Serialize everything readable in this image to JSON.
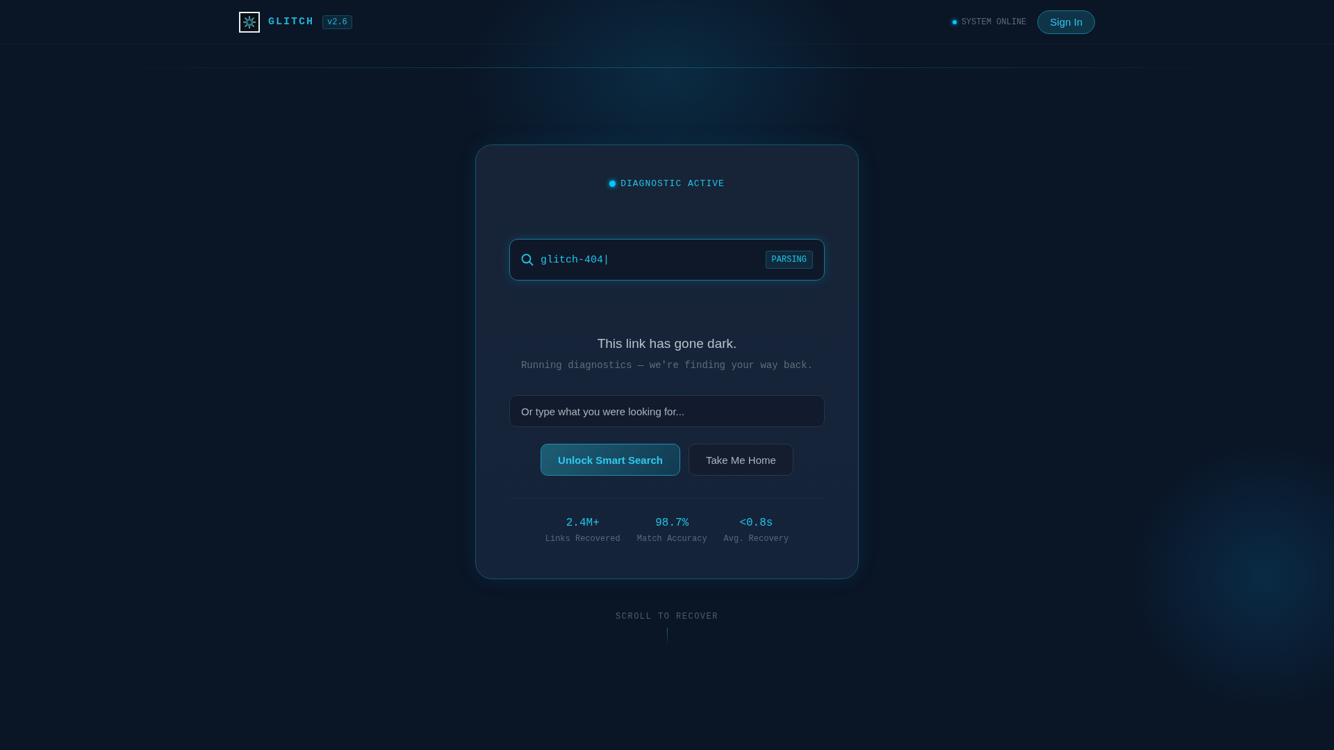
{
  "header": {
    "brand": "GLITCH",
    "version": "v2.6",
    "status": {
      "label": "SYSTEM ONLINE",
      "on": true
    },
    "sign_in": "Sign In"
  },
  "card": {
    "badge": {
      "label": "DIAGNOSTIC ACTIVE",
      "on": true
    },
    "search": {
      "value": "glitch-404|",
      "tag": "PARSING"
    },
    "title": "This link has gone dark.",
    "subtitle": "Running diagnostics — we're finding your way back.",
    "query": {
      "placeholder": "Or type what you were looking for..."
    },
    "buttons": [
      {
        "label": "Unlock Smart Search",
        "kind": "primary"
      },
      {
        "label": "Take Me Home",
        "kind": "secondary"
      }
    ],
    "stats": [
      {
        "value": "2.4M+",
        "label": "Links Recovered"
      },
      {
        "value": "98.7%",
        "label": "Match Accuracy"
      },
      {
        "value": "<0.8s",
        "label": "Avg. Recovery"
      }
    ]
  },
  "scroll_hint": "SCROLL TO RECOVER"
}
